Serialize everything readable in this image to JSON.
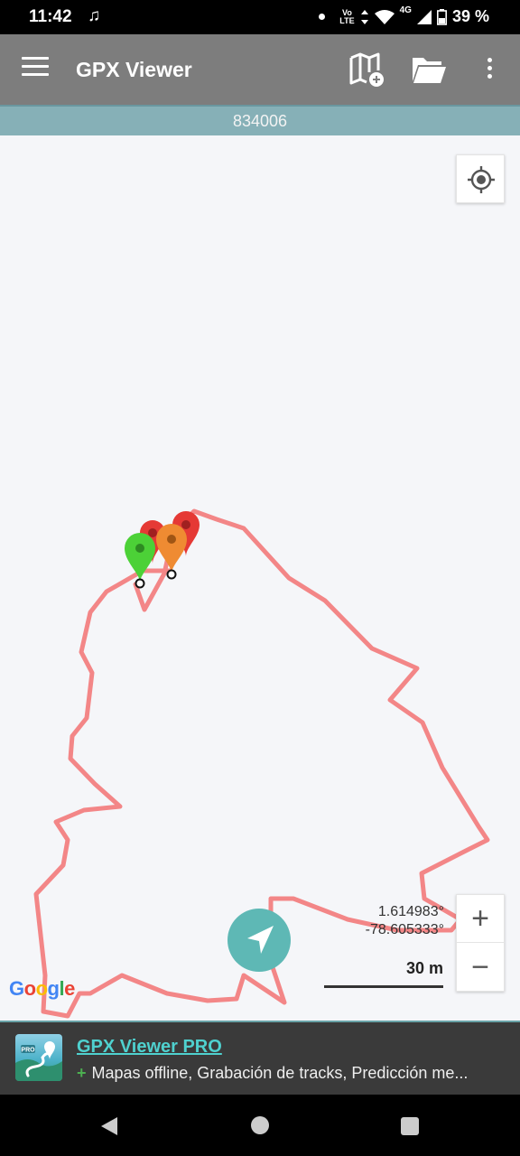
{
  "status_bar": {
    "time": "11:42",
    "music_icon": "music-note-icon",
    "volte_top": "Vo",
    "volte_bottom": "LTE",
    "network": "4G",
    "battery": "39 %"
  },
  "app_bar": {
    "title": "GPX Viewer",
    "icons": [
      "menu-icon",
      "map-add-icon",
      "folder-open-icon",
      "more-vert-icon"
    ]
  },
  "track": {
    "name": "834006"
  },
  "map": {
    "coordinates": {
      "latitude": "1.614983°",
      "longitude": "-78.605333°"
    },
    "scale_label": "30 m",
    "zoom_in": "+",
    "zoom_out": "−",
    "google_logo": {
      "letters": [
        "G",
        "o",
        "o",
        "g",
        "l",
        "e"
      ],
      "colors": [
        "#4285F4",
        "#EA4335",
        "#FBBC05",
        "#4285F4",
        "#34A853",
        "#EA4335"
      ]
    },
    "track_color": "#f26a6a",
    "accent_color": "#5eb8b5",
    "marker_colors": {
      "start": "#4caf50",
      "waypoint": "#ef8b32",
      "end": "#e53935"
    }
  },
  "ad": {
    "title": "GPX Viewer PRO",
    "plus": "+",
    "description": "Mapas offline, Grabación de tracks, Predicción me...",
    "badge": "PRO"
  },
  "nav_bar": {
    "icons": [
      "back-icon",
      "home-icon",
      "recents-icon"
    ]
  }
}
